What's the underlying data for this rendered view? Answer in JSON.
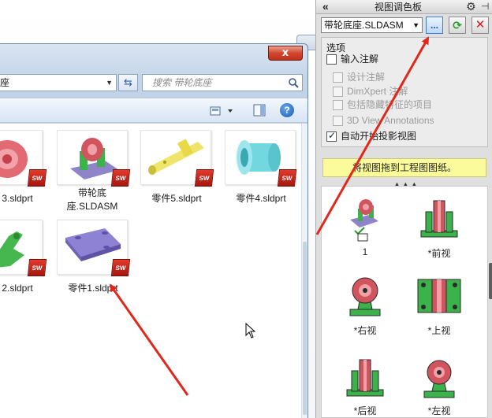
{
  "explorer": {
    "close_label": "x",
    "address_text": "座",
    "search_placeholder": "搜索 带轮底座",
    "refresh_glyph": "⇆",
    "help_label": "?",
    "files": [
      {
        "label": "3.sldprt",
        "icon": "wheel-part-icon"
      },
      {
        "label": "带轮底座.SLDASM",
        "icon": "wheel-assembly-icon"
      },
      {
        "label": "零件5.sldprt",
        "icon": "shaft-part-icon"
      },
      {
        "label": "零件4.sldprt",
        "icon": "sleeve-part-icon"
      },
      {
        "label": "2.sldprt",
        "icon": "bracket-part-icon"
      },
      {
        "label": "零件1.sldprt",
        "icon": "base-plate-part-icon"
      }
    ],
    "sw_badge": "SW"
  },
  "palette": {
    "collapse_glyph": "«",
    "title": "视图调色板",
    "gear_glyph": "⚙",
    "pin_glyph": "⊣",
    "document": "带轮底座.SLDASM",
    "browse_label": "...",
    "refresh_glyph": "⟳",
    "close_glyph": "✕",
    "options_title": "选项",
    "options": [
      {
        "label": "输入注解",
        "checked": false,
        "enabled": true
      },
      {
        "label": "设计注解",
        "checked": false,
        "enabled": false
      },
      {
        "label": "DimXpert 注解",
        "checked": false,
        "enabled": false
      },
      {
        "label": "包括隐藏特征的项目",
        "checked": false,
        "enabled": false
      },
      {
        "label": "3D View Annotations",
        "checked": false,
        "enabled": false
      },
      {
        "label": "自动开始投影视图",
        "checked": true,
        "enabled": true
      }
    ],
    "drag_hint": "将视图拖到工程图图纸。",
    "drag_handle": "▲▲▲",
    "views": [
      {
        "label": "1",
        "icon": "isometric-view-icon"
      },
      {
        "label": "*前视",
        "icon": "front-view-icon"
      },
      {
        "label": "*右视",
        "icon": "right-view-icon"
      },
      {
        "label": "*上视",
        "icon": "top-view-icon"
      },
      {
        "label": "*后视",
        "icon": "back-view-icon"
      },
      {
        "label": "*左视",
        "icon": "left-view-icon"
      }
    ]
  },
  "colors": {
    "arrow_red": "#e0281c",
    "palette_bg": "#dfdfdf",
    "hint_yellow": "#fbfb9c",
    "explorer_frame": "#c6d6ea"
  }
}
